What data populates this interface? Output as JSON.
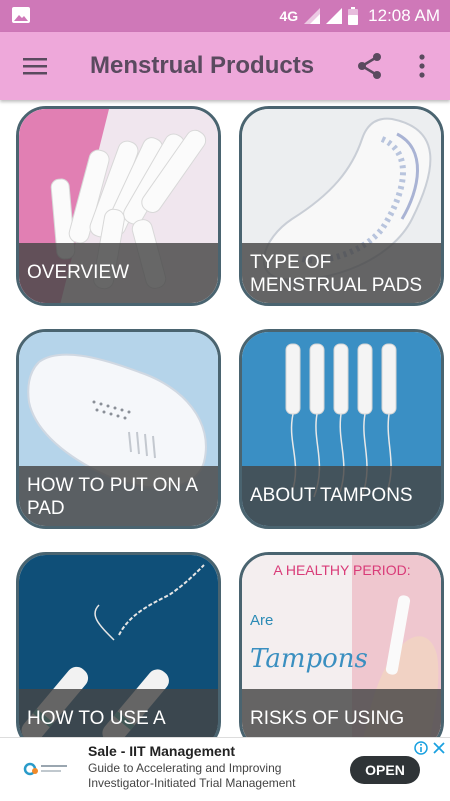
{
  "status_bar": {
    "network": "4G",
    "time": "12:08 AM",
    "icons": [
      "image-icon",
      "signal-icon",
      "signal-icon",
      "battery-icon"
    ]
  },
  "app_bar": {
    "title": "Menstrual Products",
    "icons": [
      "menu-icon",
      "share-icon",
      "more-vert-icon"
    ]
  },
  "cards": [
    {
      "label": "OVERVIEW"
    },
    {
      "label": "TYPE OF MENSTRUAL PADS"
    },
    {
      "label": "HOW TO PUT ON A PAD"
    },
    {
      "label": "ABOUT TAMPONS"
    },
    {
      "label": "HOW TO USE A"
    },
    {
      "label": "RISKS OF USING"
    }
  ],
  "card_images": {
    "risks": {
      "headline": "A HEALTHY PERIOD:",
      "word1": "Are",
      "word2": "Tampons"
    }
  },
  "ad": {
    "title": "Sale - IIT Management",
    "description": "Guide to Accelerating and Improving Investigator-Initiated Trial Management",
    "button_label": "OPEN",
    "icons": [
      "adchoices-info-icon",
      "close-icon"
    ]
  }
}
